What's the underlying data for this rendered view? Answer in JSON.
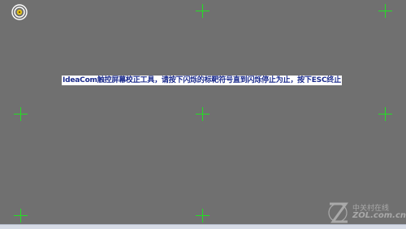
{
  "calibration": {
    "instruction": "IdeaCom触控屏幕校正工具，请按下闪烁的标靶符号直到闪烁停止为止，按下ESC终止",
    "target_icon": "bullseye-target-icon",
    "crosshair_icon": "crosshair-icon",
    "crosshair_color": "#22e022",
    "background_color": "#707070",
    "banner_text_color": "#1a2a8a"
  },
  "watermark": {
    "line1": "中关村在线",
    "line2": "ZOL.com.cn"
  }
}
